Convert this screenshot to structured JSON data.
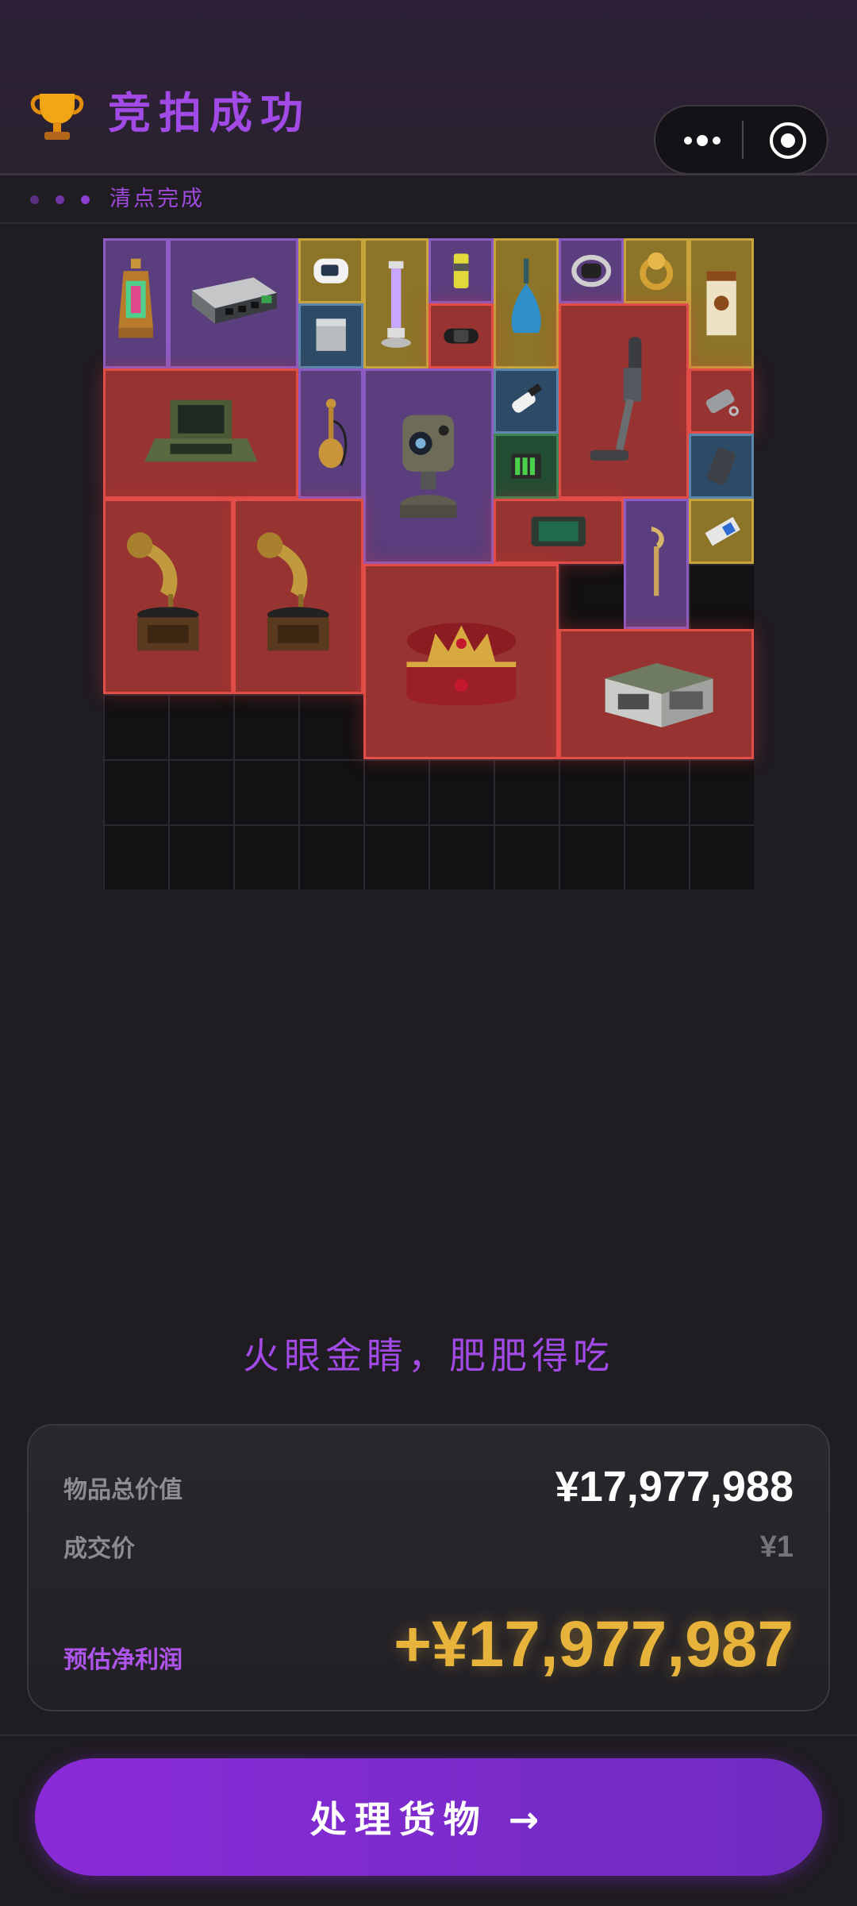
{
  "header": {
    "title": "竞拍成功",
    "icon": "trophy-icon",
    "capsule_menu_icon": "more-dots-icon",
    "capsule_close_icon": "target-circle-icon"
  },
  "status": {
    "text": "清点完成"
  },
  "inventory": {
    "grid_columns": 10,
    "grid_rows": 10,
    "items": [
      {
        "name": "lantern",
        "rarity": "purple"
      },
      {
        "name": "network-switch",
        "rarity": "purple"
      },
      {
        "name": "pulse-oximeter",
        "rarity": "gold"
      },
      {
        "name": "uv-lamp",
        "rarity": "gold"
      },
      {
        "name": "energy-drink-can",
        "rarity": "purple"
      },
      {
        "name": "perfume-bottle",
        "rarity": "gold"
      },
      {
        "name": "smart-band",
        "rarity": "purple"
      },
      {
        "name": "gold-ring",
        "rarity": "gold"
      },
      {
        "name": "coffee-box",
        "rarity": "gold"
      },
      {
        "name": "power-module",
        "rarity": "blue"
      },
      {
        "name": "fitness-tracker",
        "rarity": "red"
      },
      {
        "name": "cordless-vacuum",
        "rarity": "red"
      },
      {
        "name": "rugged-laptop",
        "rarity": "red"
      },
      {
        "name": "hookah",
        "rarity": "purple"
      },
      {
        "name": "camera-turret",
        "rarity": "purple"
      },
      {
        "name": "usb-key",
        "rarity": "blue"
      },
      {
        "name": "usb-drive",
        "rarity": "red"
      },
      {
        "name": "battery-pack",
        "rarity": "green"
      },
      {
        "name": "power-bank",
        "rarity": "blue"
      },
      {
        "name": "circuit-board",
        "rarity": "red"
      },
      {
        "name": "torch-figure",
        "rarity": "purple"
      },
      {
        "name": "ssd-drive",
        "rarity": "gold"
      },
      {
        "name": "gramophone",
        "rarity": "red"
      },
      {
        "name": "gramophone",
        "rarity": "red"
      },
      {
        "name": "crown-chest",
        "rarity": "red"
      },
      {
        "name": "military-crate",
        "rarity": "red"
      }
    ]
  },
  "slogan": "火眼金睛，肥肥得吃",
  "summary": {
    "total_label": "物品总价值",
    "total_value": "¥17,977,988",
    "deal_label": "成交价",
    "deal_value": "¥1",
    "profit_label": "预估净利润",
    "profit_value": "+¥17,977,987"
  },
  "action": {
    "label": "处理货物 →"
  },
  "colors": {
    "accent": "#a24ae6",
    "profit": "#e7b33b",
    "background": "#1f1c22",
    "rarity_red": "#973331",
    "rarity_purple": "#5a3e7e",
    "rarity_gold": "#8c7428",
    "rarity_blue": "#2d4b66",
    "rarity_green": "#234d33"
  }
}
